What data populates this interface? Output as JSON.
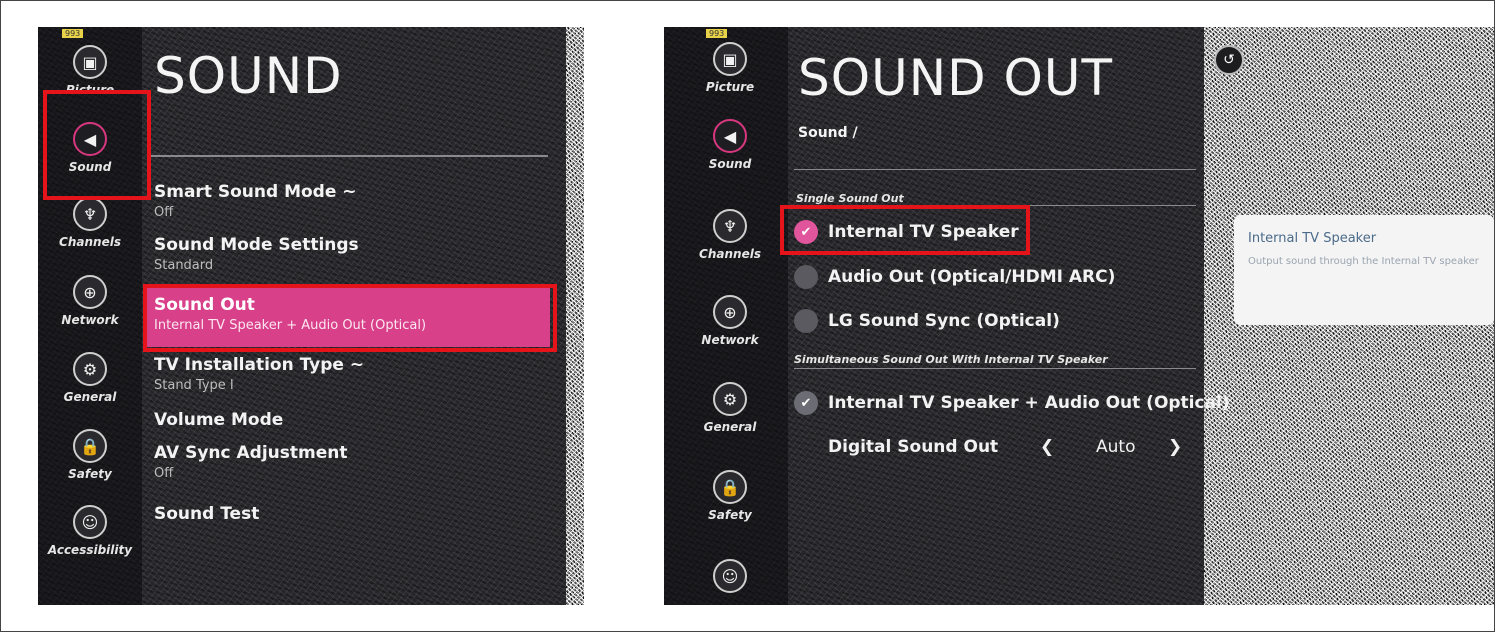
{
  "left": {
    "title": "SOUND",
    "tag": "993",
    "sidebar": [
      {
        "label": "Picture",
        "icon": "picture-icon",
        "glyph": "▣"
      },
      {
        "label": "Sound",
        "icon": "speaker-icon",
        "glyph": "◀"
      },
      {
        "label": "Channels",
        "icon": "channels-icon",
        "glyph": "♆"
      },
      {
        "label": "Network",
        "icon": "network-icon",
        "glyph": "⊕"
      },
      {
        "label": "General",
        "icon": "wrench-icon",
        "glyph": "⚙"
      },
      {
        "label": "Safety",
        "icon": "lock-icon",
        "glyph": "🔒"
      },
      {
        "label": "Accessibility",
        "icon": "accessibility-icon",
        "glyph": "☺"
      }
    ],
    "menu": [
      {
        "name": "Smart Sound Mode ~",
        "value": "Off"
      },
      {
        "name": "Sound Mode Settings",
        "value": "Standard"
      },
      {
        "name": "Sound Out",
        "value": "Internal TV Speaker + Audio Out (Optical)"
      },
      {
        "name": "TV Installation Type ~",
        "value": "Stand Type I"
      },
      {
        "name": "Volume Mode",
        "value": ""
      },
      {
        "name": "AV Sync Adjustment",
        "value": "Off"
      },
      {
        "name": "Sound Test",
        "value": ""
      }
    ]
  },
  "right": {
    "title": "SOUND OUT",
    "tag": "993",
    "breadcrumb": "Sound /",
    "sidebar": [
      {
        "label": "Picture",
        "icon": "picture-icon",
        "glyph": "▣"
      },
      {
        "label": "Sound",
        "icon": "speaker-icon",
        "glyph": "◀"
      },
      {
        "label": "Channels",
        "icon": "channels-icon",
        "glyph": "♆"
      },
      {
        "label": "Network",
        "icon": "network-icon",
        "glyph": "⊕"
      },
      {
        "label": "General",
        "icon": "wrench-icon",
        "glyph": "⚙"
      },
      {
        "label": "Safety",
        "icon": "lock-icon",
        "glyph": "🔒"
      },
      {
        "label": "",
        "icon": "accessibility-icon",
        "glyph": "☺"
      }
    ],
    "single_section": "Single Sound Out",
    "single_options": [
      {
        "label": "Internal TV Speaker",
        "selected": true
      },
      {
        "label": "Audio Out (Optical/HDMI ARC)",
        "selected": false
      },
      {
        "label": "LG Sound Sync (Optical)",
        "selected": false
      }
    ],
    "simul_section": "Simultaneous Sound Out With Internal TV Speaker",
    "simul_option": "Internal TV Speaker + Audio Out (Optical)",
    "digital_label": "Digital Sound Out",
    "digital_value": "Auto",
    "prev_glyph": "❮",
    "next_glyph": "❯",
    "check_glyph": "✔",
    "back_glyph": "↺",
    "tooltip": {
      "title": "Internal TV Speaker",
      "desc": "Output sound through the Internal TV speaker"
    }
  },
  "colors": {
    "highlight": "#d9408a",
    "annotation": "#e5141b",
    "selected_radio": "#e0559c"
  }
}
